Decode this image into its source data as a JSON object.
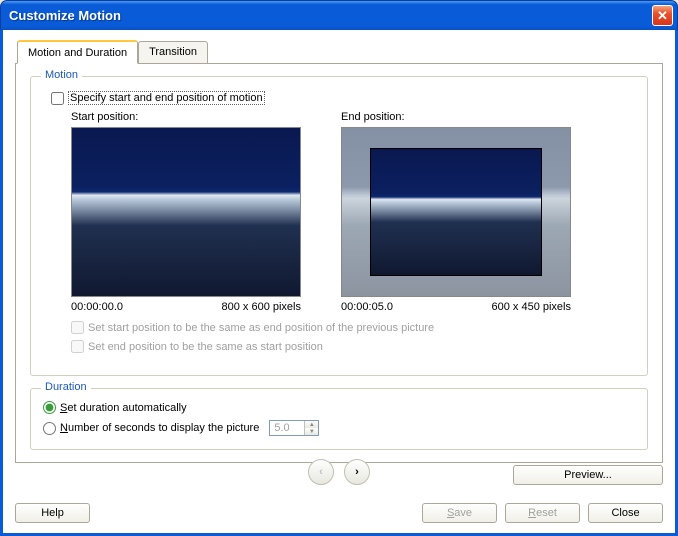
{
  "window": {
    "title": "Customize Motion"
  },
  "tabs": [
    {
      "label": "Motion and Duration",
      "active": true
    },
    {
      "label": "Transition",
      "active": false
    }
  ],
  "motion": {
    "legend": "Motion",
    "specify_label": "Specify start and end position of motion",
    "start_label": "Start position:",
    "end_label": "End position:",
    "start_time": "00:00:00.0",
    "start_size": "800 x 600 pixels",
    "end_time": "00:00:05.0",
    "end_size": "600 x 450 pixels",
    "chk_start_same": "Set start position to be the same as end position of the previous picture",
    "chk_end_same": "Set end position to be the same as start position"
  },
  "duration": {
    "legend": "Duration",
    "radio_auto": "Set duration automatically",
    "radio_seconds": "Number of seconds to display the picture",
    "seconds_value": "5.0"
  },
  "buttons": {
    "preview": "Preview...",
    "help": "Help",
    "save": "Save",
    "reset": "Reset",
    "close": "Close"
  }
}
